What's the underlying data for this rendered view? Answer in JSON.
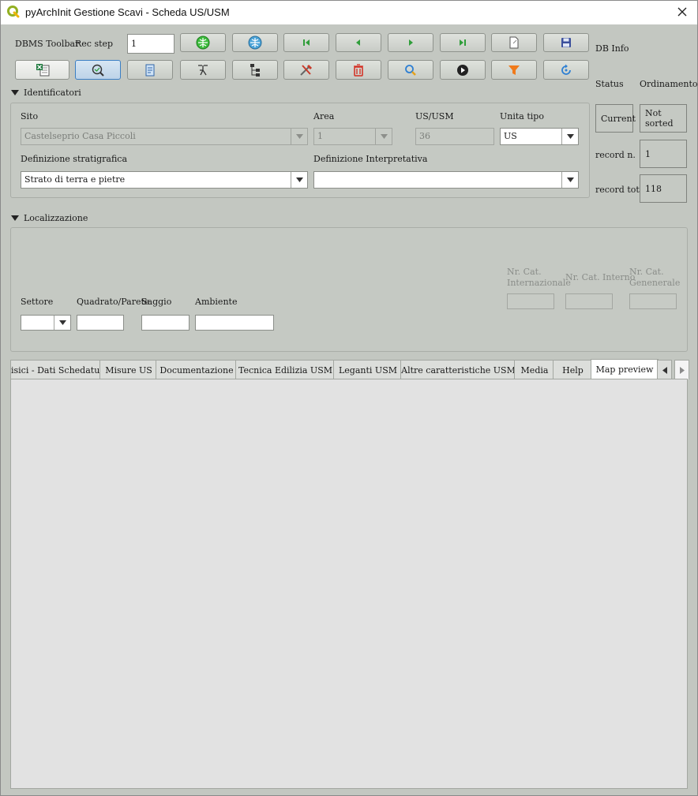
{
  "window": {
    "title": "pyArchInit Gestione Scavi - Scheda US/USM"
  },
  "toolbar": {
    "dbms_label": "DBMS Toolbar",
    "rec_step_label": "Rec step",
    "rec_step_value": "1",
    "row1_icons": [
      "db-connect-icon",
      "db-globe-icon",
      "first-record-icon",
      "prev-record-icon",
      "next-record-icon",
      "last-record-icon",
      "new-record-icon",
      "save-icon"
    ],
    "row2_icons": [
      "excel-export-icon",
      "view-mode-icon",
      "report-icon",
      "harris-matrix-icon",
      "hierarchy-icon",
      "tools-icon",
      "delete-icon",
      "search-icon",
      "run-icon",
      "filter-icon",
      "refresh-icon"
    ]
  },
  "db_info": {
    "title": "DB Info",
    "status_label": "Status",
    "ordering_label": "Ordinamento",
    "status_value": "Current",
    "ordering_value": "Not sorted",
    "record_n_label": "record n.",
    "record_n_value": "1",
    "record_tot_label": "record tot.",
    "record_tot_value": "118"
  },
  "identificatori": {
    "header": "Identificatori",
    "sito_label": "Sito",
    "sito_value": "Castelseprio Casa Piccoli",
    "area_label": "Area",
    "area_value": "1",
    "us_label": "US/USM",
    "us_value": "36",
    "unita_label": "Unita tipo",
    "unita_value": "US",
    "def_strat_label": "Definizione stratigrafica",
    "def_strat_value": "Strato di terra e pietre",
    "def_interp_label": "Definizione Interpretativa",
    "def_interp_value": ""
  },
  "localizzazione": {
    "header": "Localizzazione",
    "settore_label": "Settore",
    "quadrato_label": "Quadrato/Parete",
    "saggio_label": "Saggio",
    "ambiente_label": "Ambiente",
    "nr_cat_int_label": "Nr. Cat. Internazionale",
    "nr_cat_interno_label": "Nr. Cat. Interno",
    "nr_cat_gen_label": "Nr. Cat. Genenerale"
  },
  "tabs": [
    {
      "label": "isici - Dati Schedatura"
    },
    {
      "label": "Misure US"
    },
    {
      "label": "Documentazione"
    },
    {
      "label": "Tecnica Edilizia USM"
    },
    {
      "label": "Leganti USM"
    },
    {
      "label": "Altre caratteristiche USM"
    },
    {
      "label": "Media"
    },
    {
      "label": "Help"
    },
    {
      "label": "Map preview"
    }
  ],
  "selected_tab": "Map preview",
  "colors": {
    "background": "#c3c7c1",
    "panel": "#e2e2e2",
    "accent": "#3b7fc4"
  }
}
